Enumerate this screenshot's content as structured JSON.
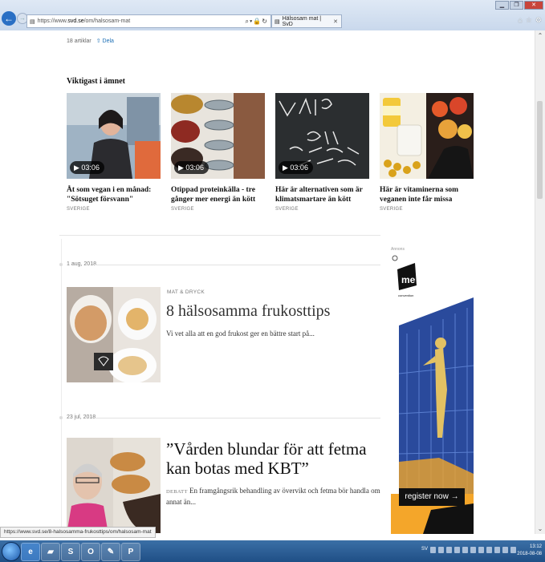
{
  "browser": {
    "url_prefix": "https://www.",
    "url_domain": "svd.se",
    "url_path": "/om/halsosam-mat",
    "tab_title": "Hälsosam mat | SvD",
    "status_url": "https://www.svd.se/8-halsosamma-frukosttips/om/halsosam-mat"
  },
  "page": {
    "article_count": "18 artiklar",
    "share_label": "Dela",
    "section_title": "Viktigast i ämnet",
    "cards": [
      {
        "duration": "03:06",
        "title": "Åt som vegan i en månad: \"Sötsuget försvann\"",
        "tag": "SVERIGE"
      },
      {
        "duration": "03:06",
        "title": "Otippad proteinkälla - tre gånger mer energi än kött",
        "tag": "SVERIGE"
      },
      {
        "duration": "03:06",
        "title": "Här är alternativen som är klimatsmartare än kött",
        "tag": "SVERIGE"
      },
      {
        "title": "Här är vitaminerna som veganen inte får missa",
        "tag": "SVERIGE"
      }
    ],
    "articles": [
      {
        "date": "1 aug, 2018",
        "category": "MAT & DRYCK",
        "title": "8 hälsosamma frukosttips",
        "desc": "Vi vet alla att en god frukost ger en bättre start på..."
      },
      {
        "date": "23 jul, 2018",
        "category": "DEBATT",
        "title": "”Vården blundar för att fetma kan botas med KBT”",
        "desc": "En framgångsrik behandling av övervikt och fetma bör handla om annat än..."
      }
    ],
    "ad": {
      "label": "Annons",
      "brand": "me",
      "brand_sub": "convention",
      "cta": "register now"
    }
  },
  "taskbar": {
    "time": "13:12",
    "date": "2018-08-08",
    "lang": "SV"
  }
}
